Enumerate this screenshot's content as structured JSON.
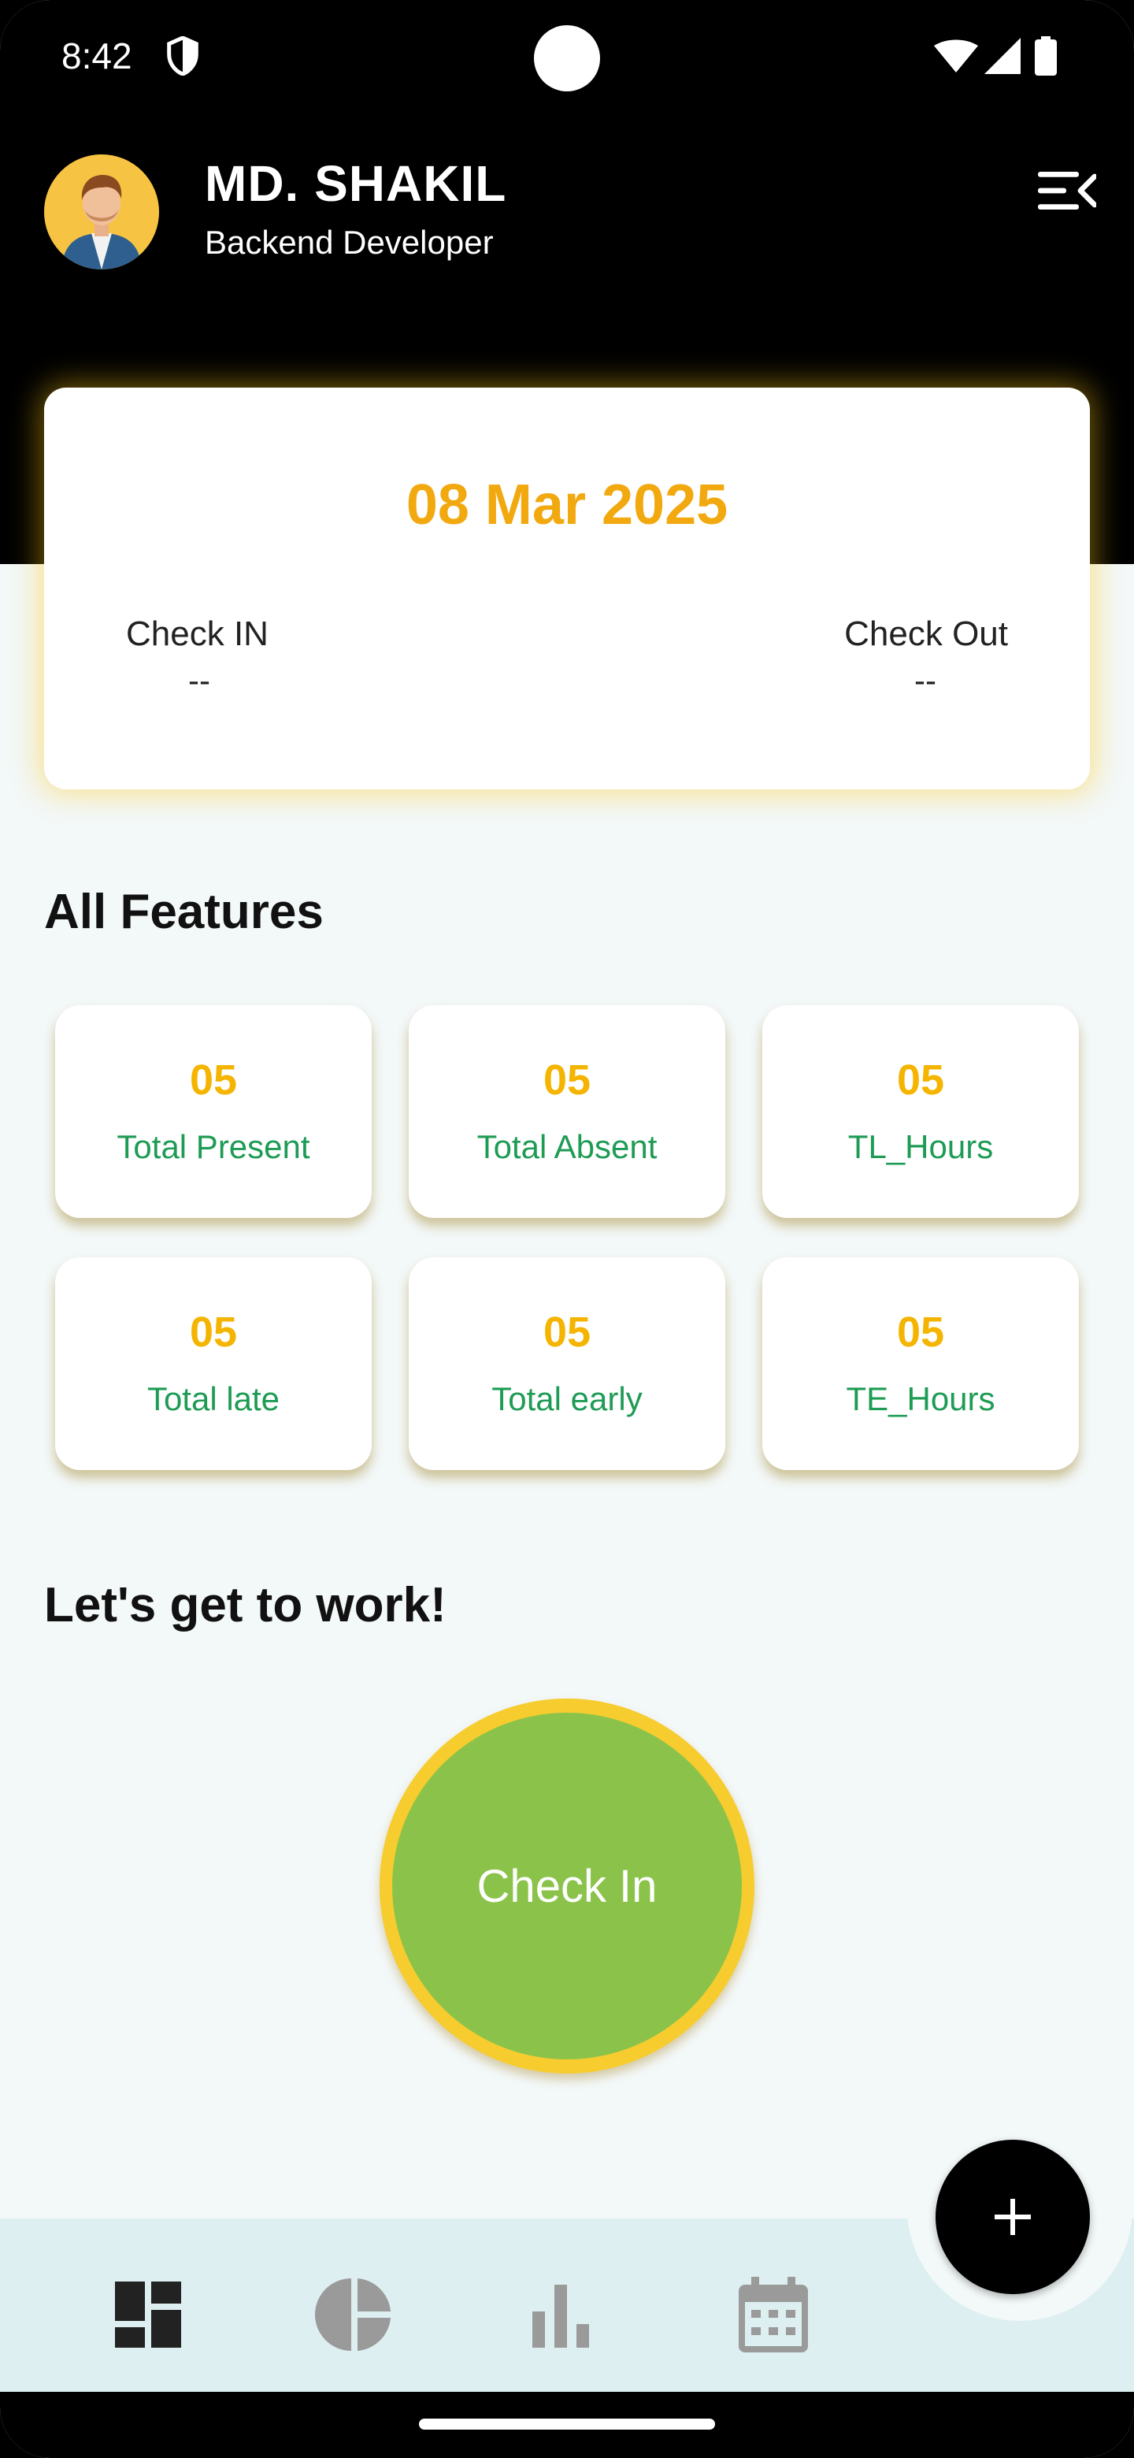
{
  "status_bar": {
    "time": "8:42"
  },
  "profile": {
    "name": "MD. SHAKIL",
    "role": "Backend Developer"
  },
  "date_card": {
    "date": "08 Mar 2025",
    "check_in_label": "Check IN",
    "check_in_value": "--",
    "check_out_label": "Check Out",
    "check_out_value": "--"
  },
  "features": {
    "title": "All Features",
    "tiles": [
      {
        "value": "05",
        "label": "Total Present"
      },
      {
        "value": "05",
        "label": "Total Absent"
      },
      {
        "value": "05",
        "label": "TL_Hours"
      },
      {
        "value": "05",
        "label": "Total late"
      },
      {
        "value": "05",
        "label": "Total early"
      },
      {
        "value": "05",
        "label": "TE_Hours"
      }
    ]
  },
  "work": {
    "title": "Let's get to work!",
    "check_in_button": "Check In"
  },
  "bottom_nav": {
    "items": [
      "dashboard-icon",
      "pie-chart-icon",
      "bar-chart-icon",
      "calendar-icon"
    ],
    "fab_icon": "plus-icon"
  },
  "colors": {
    "accent_yellow": "#f4b400",
    "label_green": "#1e9b54",
    "checkin_green": "#8bc34a",
    "header_black": "#000000"
  }
}
